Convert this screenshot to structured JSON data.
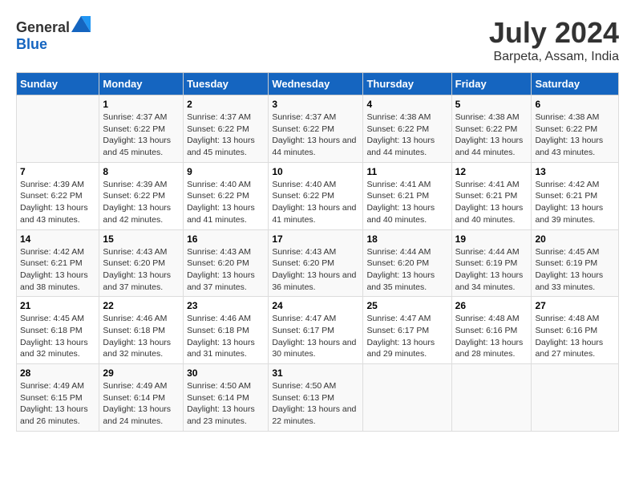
{
  "header": {
    "logo_general": "General",
    "logo_blue": "Blue",
    "title": "July 2024",
    "subtitle": "Barpeta, Assam, India"
  },
  "days_of_week": [
    "Sunday",
    "Monday",
    "Tuesday",
    "Wednesday",
    "Thursday",
    "Friday",
    "Saturday"
  ],
  "weeks": [
    [
      {
        "day": "",
        "sunrise": "",
        "sunset": "",
        "daylight": ""
      },
      {
        "day": "1",
        "sunrise": "Sunrise: 4:37 AM",
        "sunset": "Sunset: 6:22 PM",
        "daylight": "Daylight: 13 hours and 45 minutes."
      },
      {
        "day": "2",
        "sunrise": "Sunrise: 4:37 AM",
        "sunset": "Sunset: 6:22 PM",
        "daylight": "Daylight: 13 hours and 45 minutes."
      },
      {
        "day": "3",
        "sunrise": "Sunrise: 4:37 AM",
        "sunset": "Sunset: 6:22 PM",
        "daylight": "Daylight: 13 hours and 44 minutes."
      },
      {
        "day": "4",
        "sunrise": "Sunrise: 4:38 AM",
        "sunset": "Sunset: 6:22 PM",
        "daylight": "Daylight: 13 hours and 44 minutes."
      },
      {
        "day": "5",
        "sunrise": "Sunrise: 4:38 AM",
        "sunset": "Sunset: 6:22 PM",
        "daylight": "Daylight: 13 hours and 44 minutes."
      },
      {
        "day": "6",
        "sunrise": "Sunrise: 4:38 AM",
        "sunset": "Sunset: 6:22 PM",
        "daylight": "Daylight: 13 hours and 43 minutes."
      }
    ],
    [
      {
        "day": "7",
        "sunrise": "Sunrise: 4:39 AM",
        "sunset": "Sunset: 6:22 PM",
        "daylight": "Daylight: 13 hours and 43 minutes."
      },
      {
        "day": "8",
        "sunrise": "Sunrise: 4:39 AM",
        "sunset": "Sunset: 6:22 PM",
        "daylight": "Daylight: 13 hours and 42 minutes."
      },
      {
        "day": "9",
        "sunrise": "Sunrise: 4:40 AM",
        "sunset": "Sunset: 6:22 PM",
        "daylight": "Daylight: 13 hours and 41 minutes."
      },
      {
        "day": "10",
        "sunrise": "Sunrise: 4:40 AM",
        "sunset": "Sunset: 6:22 PM",
        "daylight": "Daylight: 13 hours and 41 minutes."
      },
      {
        "day": "11",
        "sunrise": "Sunrise: 4:41 AM",
        "sunset": "Sunset: 6:21 PM",
        "daylight": "Daylight: 13 hours and 40 minutes."
      },
      {
        "day": "12",
        "sunrise": "Sunrise: 4:41 AM",
        "sunset": "Sunset: 6:21 PM",
        "daylight": "Daylight: 13 hours and 40 minutes."
      },
      {
        "day": "13",
        "sunrise": "Sunrise: 4:42 AM",
        "sunset": "Sunset: 6:21 PM",
        "daylight": "Daylight: 13 hours and 39 minutes."
      }
    ],
    [
      {
        "day": "14",
        "sunrise": "Sunrise: 4:42 AM",
        "sunset": "Sunset: 6:21 PM",
        "daylight": "Daylight: 13 hours and 38 minutes."
      },
      {
        "day": "15",
        "sunrise": "Sunrise: 4:43 AM",
        "sunset": "Sunset: 6:20 PM",
        "daylight": "Daylight: 13 hours and 37 minutes."
      },
      {
        "day": "16",
        "sunrise": "Sunrise: 4:43 AM",
        "sunset": "Sunset: 6:20 PM",
        "daylight": "Daylight: 13 hours and 37 minutes."
      },
      {
        "day": "17",
        "sunrise": "Sunrise: 4:43 AM",
        "sunset": "Sunset: 6:20 PM",
        "daylight": "Daylight: 13 hours and 36 minutes."
      },
      {
        "day": "18",
        "sunrise": "Sunrise: 4:44 AM",
        "sunset": "Sunset: 6:20 PM",
        "daylight": "Daylight: 13 hours and 35 minutes."
      },
      {
        "day": "19",
        "sunrise": "Sunrise: 4:44 AM",
        "sunset": "Sunset: 6:19 PM",
        "daylight": "Daylight: 13 hours and 34 minutes."
      },
      {
        "day": "20",
        "sunrise": "Sunrise: 4:45 AM",
        "sunset": "Sunset: 6:19 PM",
        "daylight": "Daylight: 13 hours and 33 minutes."
      }
    ],
    [
      {
        "day": "21",
        "sunrise": "Sunrise: 4:45 AM",
        "sunset": "Sunset: 6:18 PM",
        "daylight": "Daylight: 13 hours and 32 minutes."
      },
      {
        "day": "22",
        "sunrise": "Sunrise: 4:46 AM",
        "sunset": "Sunset: 6:18 PM",
        "daylight": "Daylight: 13 hours and 32 minutes."
      },
      {
        "day": "23",
        "sunrise": "Sunrise: 4:46 AM",
        "sunset": "Sunset: 6:18 PM",
        "daylight": "Daylight: 13 hours and 31 minutes."
      },
      {
        "day": "24",
        "sunrise": "Sunrise: 4:47 AM",
        "sunset": "Sunset: 6:17 PM",
        "daylight": "Daylight: 13 hours and 30 minutes."
      },
      {
        "day": "25",
        "sunrise": "Sunrise: 4:47 AM",
        "sunset": "Sunset: 6:17 PM",
        "daylight": "Daylight: 13 hours and 29 minutes."
      },
      {
        "day": "26",
        "sunrise": "Sunrise: 4:48 AM",
        "sunset": "Sunset: 6:16 PM",
        "daylight": "Daylight: 13 hours and 28 minutes."
      },
      {
        "day": "27",
        "sunrise": "Sunrise: 4:48 AM",
        "sunset": "Sunset: 6:16 PM",
        "daylight": "Daylight: 13 hours and 27 minutes."
      }
    ],
    [
      {
        "day": "28",
        "sunrise": "Sunrise: 4:49 AM",
        "sunset": "Sunset: 6:15 PM",
        "daylight": "Daylight: 13 hours and 26 minutes."
      },
      {
        "day": "29",
        "sunrise": "Sunrise: 4:49 AM",
        "sunset": "Sunset: 6:14 PM",
        "daylight": "Daylight: 13 hours and 24 minutes."
      },
      {
        "day": "30",
        "sunrise": "Sunrise: 4:50 AM",
        "sunset": "Sunset: 6:14 PM",
        "daylight": "Daylight: 13 hours and 23 minutes."
      },
      {
        "day": "31",
        "sunrise": "Sunrise: 4:50 AM",
        "sunset": "Sunset: 6:13 PM",
        "daylight": "Daylight: 13 hours and 22 minutes."
      },
      {
        "day": "",
        "sunrise": "",
        "sunset": "",
        "daylight": ""
      },
      {
        "day": "",
        "sunrise": "",
        "sunset": "",
        "daylight": ""
      },
      {
        "day": "",
        "sunrise": "",
        "sunset": "",
        "daylight": ""
      }
    ]
  ]
}
